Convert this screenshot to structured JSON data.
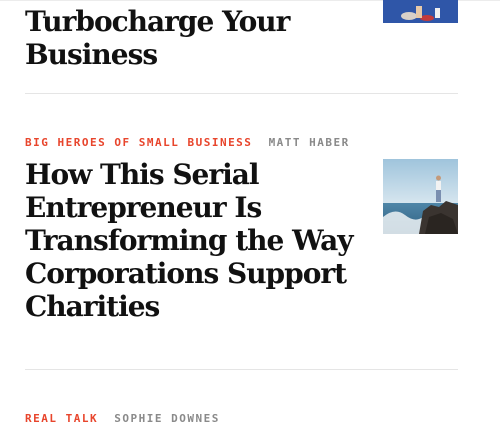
{
  "articles": [
    {
      "headline": "Critical: Use Them to Turbocharge Your Business"
    },
    {
      "category": "BIG HEROES OF SMALL BUSINESS",
      "author": "MATT HABER",
      "headline": "How This Serial Entrepreneur Is Transforming the Way Corporations Support Charities"
    },
    {
      "category": "REAL TALK",
      "author": "SOPHIE DOWNES"
    }
  ],
  "colors": {
    "category": "#e8452c",
    "author": "#8a8a8a",
    "headline": "#111111"
  },
  "icons": {
    "thumb1": "blue-scene-image",
    "thumb2": "man-on-rocks-by-sea-image"
  }
}
